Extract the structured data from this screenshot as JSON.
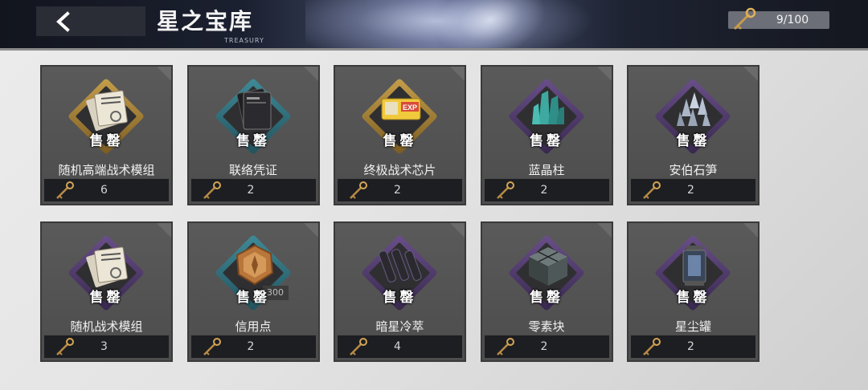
{
  "header": {
    "title": "星之宝库",
    "subtitle": "TREASURY",
    "key_count": "9/100"
  },
  "shop": {
    "sold_label": "售罄",
    "items": [
      {
        "name": "随机高端战术模组",
        "price": "6",
        "frame": "gold",
        "art": "module"
      },
      {
        "name": "联络凭证",
        "price": "2",
        "frame": "teal",
        "art": "card"
      },
      {
        "name": "终极战术芯片",
        "price": "2",
        "frame": "gold",
        "art": "chip"
      },
      {
        "name": "蓝晶柱",
        "price": "2",
        "frame": "purple",
        "art": "crystal"
      },
      {
        "name": "安伯石笋",
        "price": "2",
        "frame": "purple",
        "art": "stone"
      },
      {
        "name": "随机战术模组",
        "price": "3",
        "frame": "purple",
        "art": "module"
      },
      {
        "name": "信用点",
        "price": "2",
        "frame": "teal",
        "art": "coin",
        "badge": "300"
      },
      {
        "name": "暗星冷萃",
        "price": "4",
        "frame": "purple",
        "art": "tubes"
      },
      {
        "name": "零素块",
        "price": "2",
        "frame": "purple",
        "art": "cube"
      },
      {
        "name": "星尘罐",
        "price": "2",
        "frame": "purple",
        "art": "lantern"
      }
    ]
  }
}
